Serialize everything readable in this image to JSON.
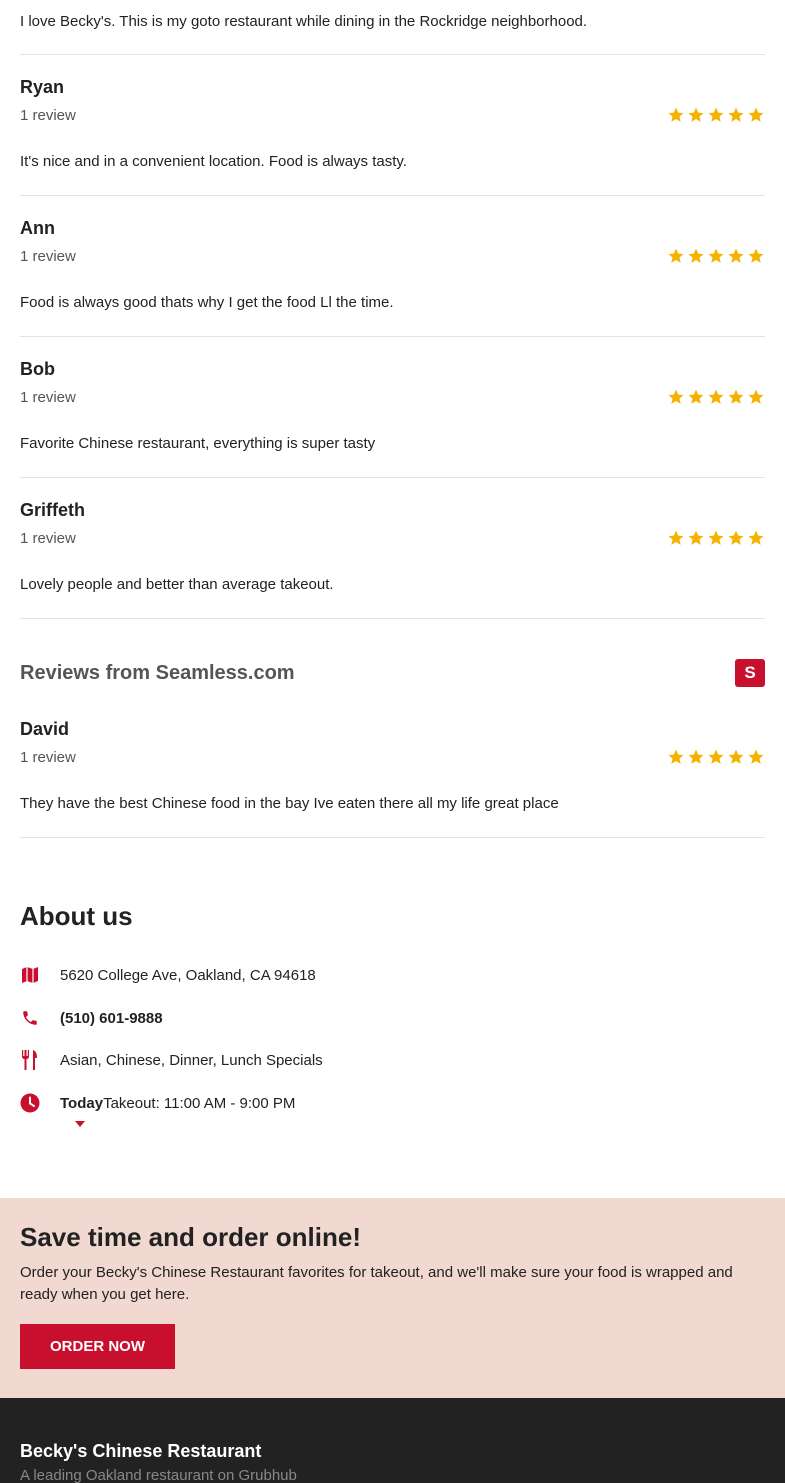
{
  "first_review": {
    "text": "I love Becky's. This is my goto restaurant while dining in the Rockridge neighborhood."
  },
  "reviews": [
    {
      "name": "Ryan",
      "count": "1 review",
      "rating": 5,
      "text": "It's nice and in a convenient location. Food is always tasty."
    },
    {
      "name": "Ann",
      "count": "1 review",
      "rating": 5,
      "text": "Food is always good thats why I get the food Ll the time."
    },
    {
      "name": "Bob",
      "count": "1 review",
      "rating": 5,
      "text": "Favorite Chinese restaurant, everything is super tasty"
    },
    {
      "name": "Griffeth",
      "count": "1 review",
      "rating": 5,
      "text": "Lovely people and better than average takeout."
    }
  ],
  "seamless": {
    "title": "Reviews from Seamless.com",
    "logo_letter": "S",
    "logo_color": "#c8102e",
    "reviews": [
      {
        "name": "David",
        "count": "1 review",
        "rating": 5,
        "text": "They have the best Chinese food in the bay Ive eaten there all my life great place"
      }
    ]
  },
  "about": {
    "title": "About us",
    "address": "5620 College Ave, Oakland, CA 94618",
    "phone": "(510) 601-9888",
    "cuisines": "Asian, Chinese, Dinner, Lunch Specials",
    "hours_day": "Today",
    "hours_text": "Takeout: 11:00 AM - 9:00 PM",
    "icons": {
      "address": "map-icon",
      "phone": "phone-icon",
      "cuisines": "utensils-icon",
      "hours": "clock-icon",
      "expand": "caret-down-icon"
    }
  },
  "promo": {
    "title": "Save time and order online!",
    "text": "Order your Becky's Chinese Restaurant favorites for takeout, and we'll make sure your food is wrapped and ready when you get here.",
    "button_label": "ORDER NOW",
    "background": "#f1d8d1"
  },
  "footer": {
    "brand": "Becky's Chinese Restaurant",
    "tagline": "A leading Oakland restaurant on Grubhub"
  },
  "colors": {
    "accent": "#c8102e",
    "star": "#f5b301",
    "footer_bg": "#222222"
  }
}
